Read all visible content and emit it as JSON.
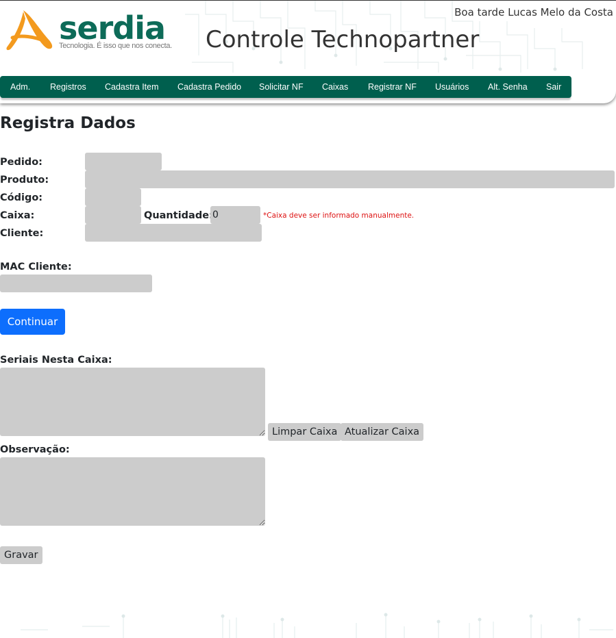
{
  "header": {
    "logo_word": "serdia",
    "logo_tagline": "Tecnologia. É isso que nos conecta.",
    "app_title": "Controle Technopartner",
    "greeting": "Boa tarde Lucas Melo da Costa",
    "brand_color": "#005f4e",
    "logo_accent": "#f39a1e"
  },
  "nav": {
    "items": [
      "Adm.",
      "Registros",
      "Cadastra Item",
      "Cadastra Pedido",
      "Solicitar NF",
      "Caixas",
      "Registrar NF",
      "Usuários",
      "Alt. Senha",
      "Sair"
    ]
  },
  "form": {
    "title": "Registra Dados",
    "pedido_label": "Pedido:",
    "produto_label": "Produto:",
    "codigo_label": "Código:",
    "caixa_label": "Caixa:",
    "quantidade_label": "Quantidade:",
    "quantidade_value": "0",
    "caixa_hint": "*Caixa deve ser informado manualmente.",
    "cliente_label": "Cliente:",
    "mac_label": "MAC Cliente:",
    "continuar_label": "Continuar",
    "seriais_label": "Seriais Nesta Caixa:",
    "limpar_label": "Limpar Caixa",
    "atualizar_label": "Atualizar Caixa",
    "observacao_label": "Observação:",
    "gravar_label": "Gravar"
  }
}
